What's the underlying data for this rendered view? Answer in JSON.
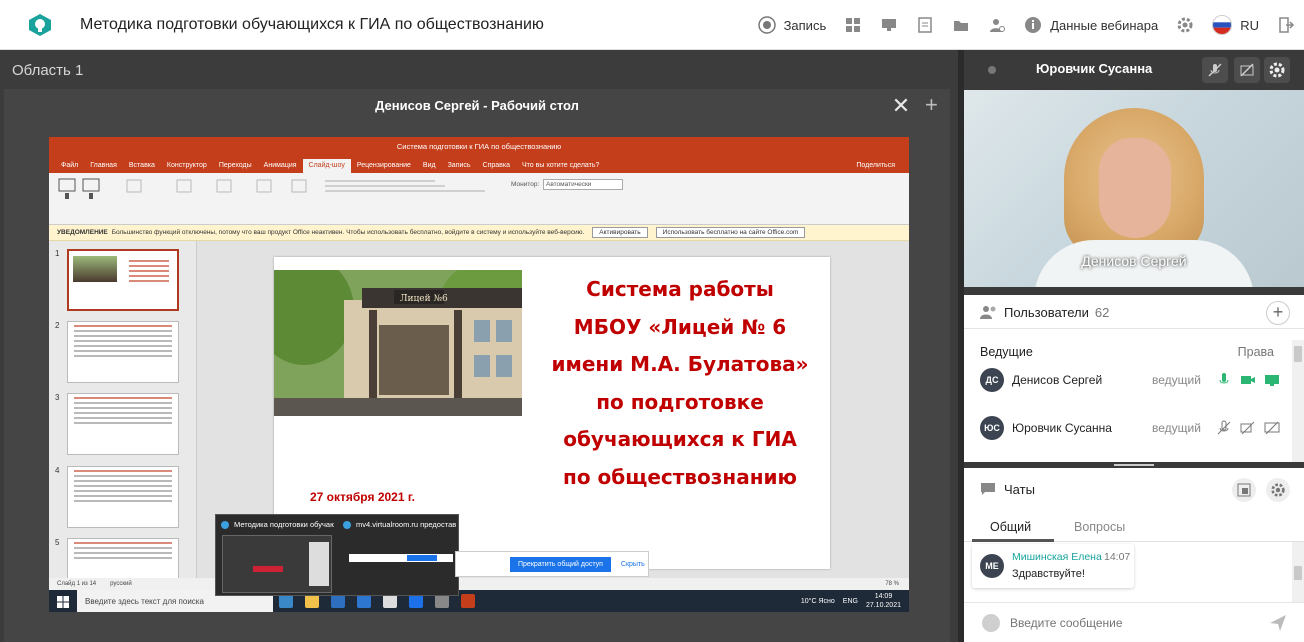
{
  "topbar": {
    "title": "Методика подготовки обучающихся к ГИА по обществознанию",
    "record_label": "Запись",
    "webinar_data_label": "Данные вебинара",
    "lang": "RU"
  },
  "area": {
    "label": "Область 1",
    "window_title": "Денисов Сергей - Рабочий стол"
  },
  "powerpoint": {
    "title": "Система подготовки к ГИА по обществознанию",
    "tabs": [
      "Файл",
      "Главная",
      "Вставка",
      "Конструктор",
      "Переходы",
      "Анимация",
      "Слайд-шоу",
      "Рецензирование",
      "Вид",
      "Запись",
      "Справка"
    ],
    "active_tab": "Слайд-шоу",
    "help_search": "Что вы хотите сделать?",
    "share": "Поделиться",
    "warning_label": "УВЕДОМЛЕНИЕ",
    "warning_text": "Большинство функций отключены, потому что ваш продукт Office неактивен. Чтобы использовать бесплатно, войдите в систему и используйте веб-версию.",
    "warning_btn1": "Активировать",
    "warning_btn2": "Использовать бесплатно на сайте Office.com",
    "monitor_label": "Монитор:",
    "monitor_value": "Автоматически",
    "thumb_numbers": [
      "1",
      "2",
      "3",
      "4",
      "5"
    ],
    "slide_lines": [
      "Система работы",
      "МБОУ «Лицей № 6",
      "имени М.А. Булатова»",
      "по подготовке",
      "обучающихся к ГИА",
      "по обществознанию"
    ],
    "slide_date": "27 октября 2021 г.",
    "status_left": "Слайд 1 из 14",
    "status_lang": "русский",
    "zoom": "78 %"
  },
  "taskbar": {
    "search_placeholder": "Введите здесь текст для поиска",
    "weather": "10°C Ясно",
    "lang": "ENG",
    "time": "14:09",
    "date": "27.10.2021"
  },
  "preview": {
    "left_caption": "Методика подготовки обучаю...",
    "right_caption": "mv4.virtualroom.ru предостав..."
  },
  "sharebar": {
    "stop_label": "Прекратить общий доступ",
    "hide_label": "Скрыть"
  },
  "right_panel": {
    "presenter_name": "Юровчик Сусанна",
    "video_caption": "Денисов Сергей",
    "users_label": "Пользователи",
    "users_count": "62",
    "leads_label": "Ведущие",
    "rights_label": "Права",
    "users": [
      {
        "initials": "ДС",
        "name": "Денисов Сергей",
        "role": "ведущий"
      },
      {
        "initials": "ЮС",
        "name": "Юровчик Сусанна",
        "role": "ведущий"
      }
    ],
    "chats_label": "Чаты",
    "chat_tabs": [
      "Общий",
      "Вопросы"
    ],
    "message": {
      "initials": "МЕ",
      "author": "Мишинская Елена",
      "time": "14:07",
      "text": "Здравствуйте!"
    },
    "input_placeholder": "Введите сообщение"
  },
  "colors": {
    "accent": "#1aa39c",
    "ppt_red": "#c43e1c",
    "slide_text": "#c00000",
    "mic_on": "#2bb673"
  }
}
